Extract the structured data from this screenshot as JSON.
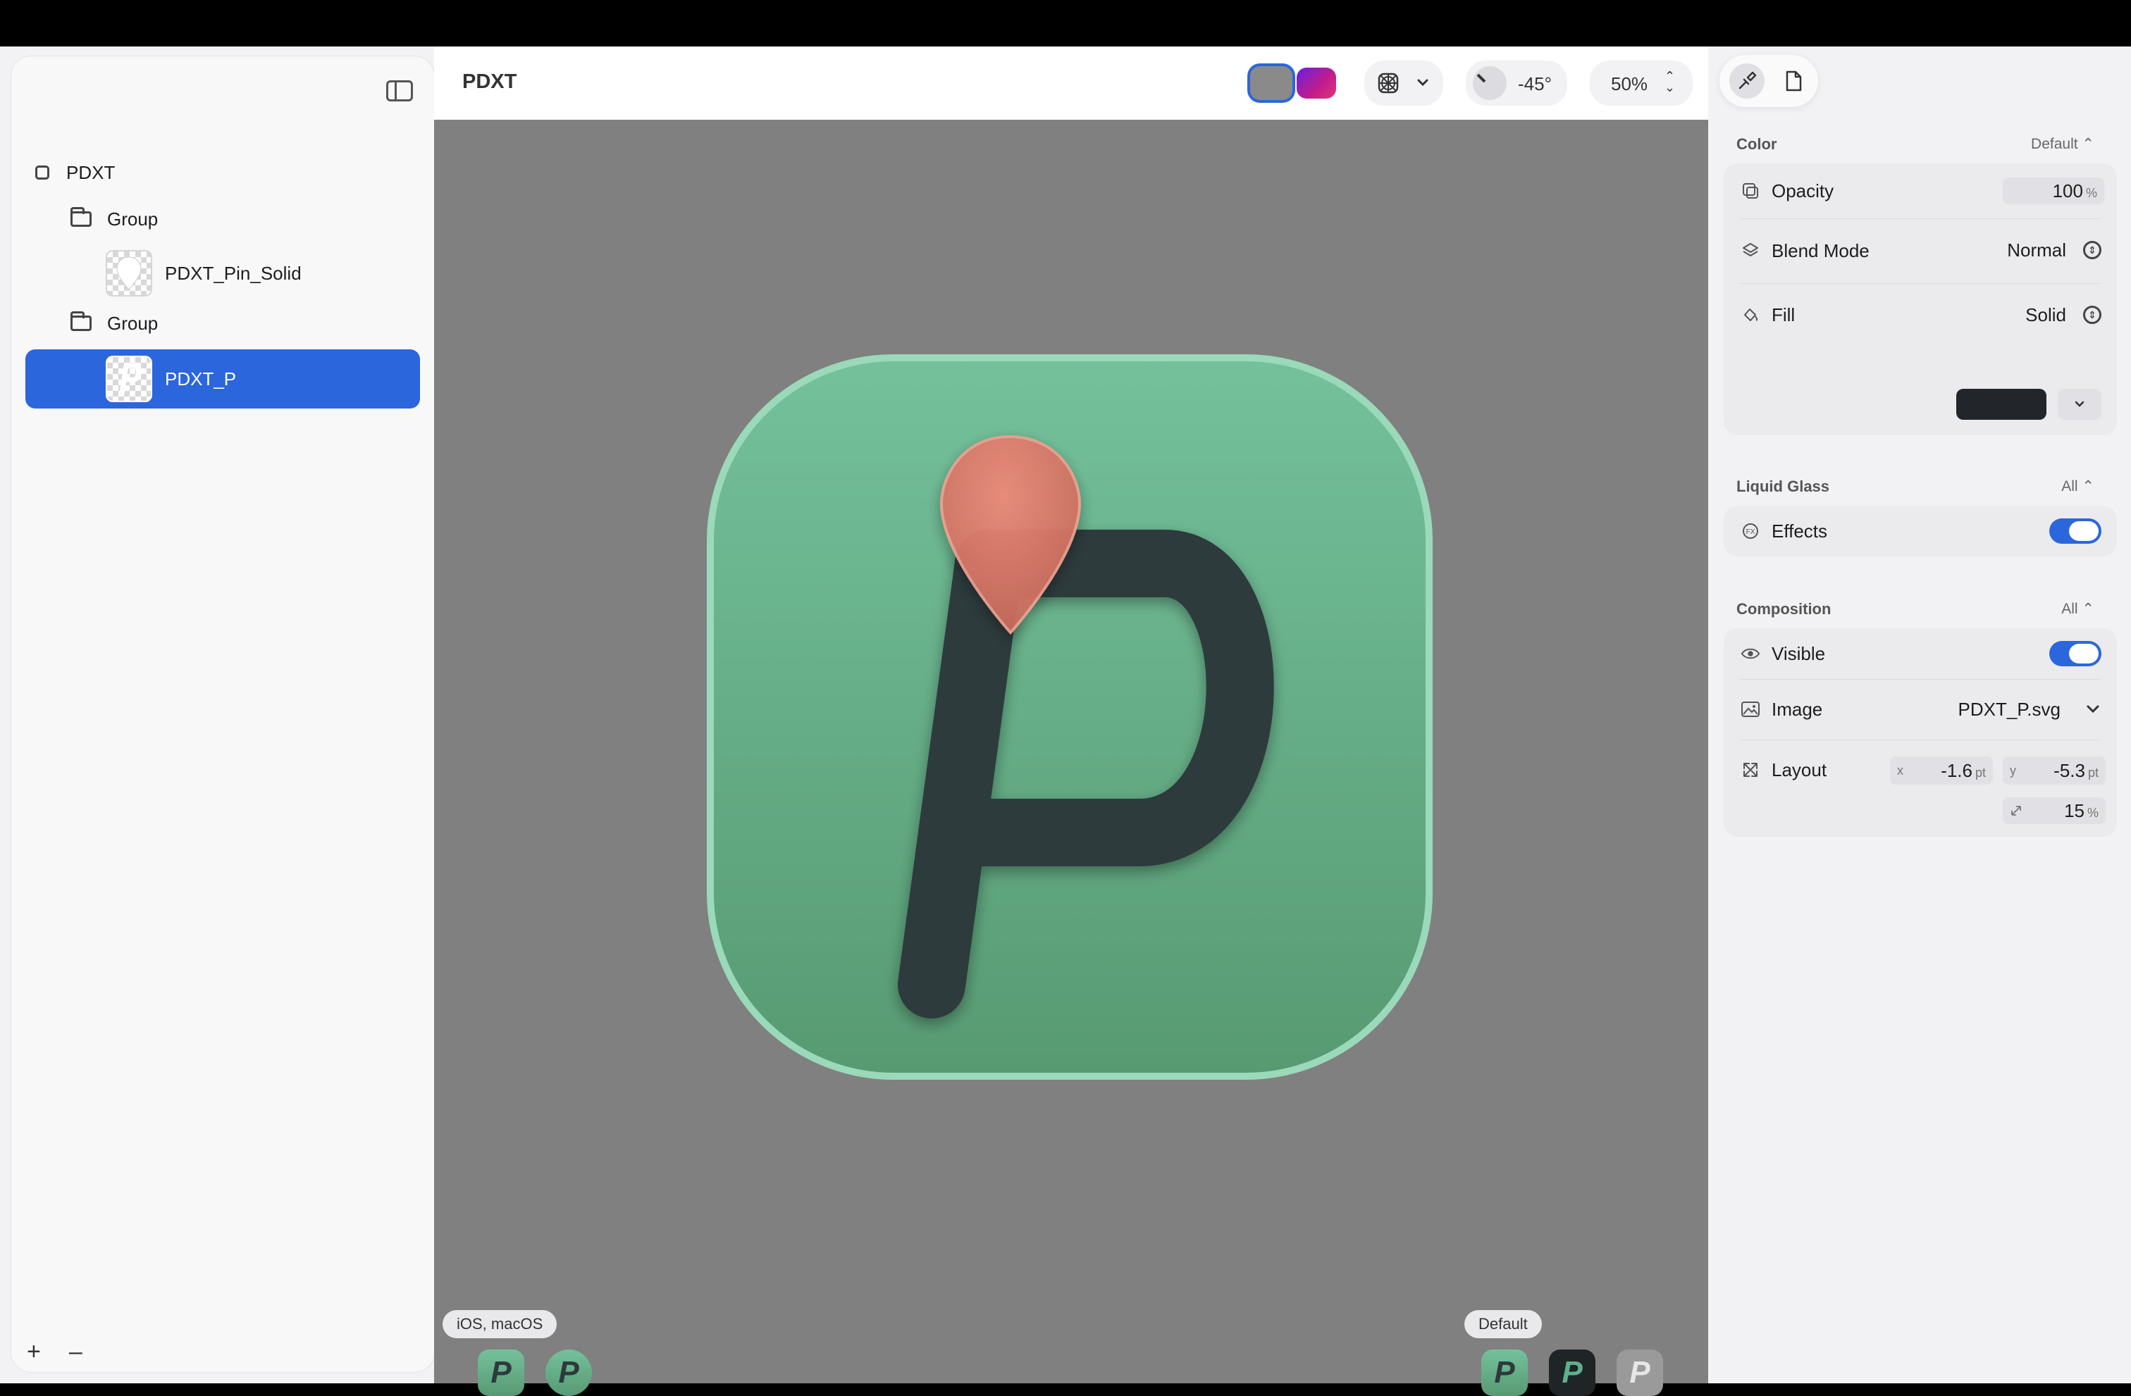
{
  "sidebar": {
    "items": [
      {
        "label": "PDXT",
        "kind": "document"
      },
      {
        "label": "Group",
        "kind": "group"
      },
      {
        "label": "PDXT_Pin_Solid",
        "kind": "layer"
      },
      {
        "label": "Group",
        "kind": "group"
      },
      {
        "label": "PDXT_P",
        "kind": "layer",
        "selected": true
      }
    ],
    "add_label": "+",
    "remove_label": "–"
  },
  "header": {
    "title": "PDXT",
    "angle": "-45°",
    "zoom": "50%"
  },
  "canvas": {
    "platform_badge": "iOS, macOS",
    "appearance_badge": "Default",
    "icon_letter": "P",
    "colors": {
      "background": "#808080",
      "icon_green": "#67b78f",
      "glyph": "#2d3a3c",
      "pin": "#e07565"
    }
  },
  "inspector": {
    "color": {
      "heading": "Color",
      "mode": "Default ⌃",
      "opacity_label": "Opacity",
      "opacity_value": "100",
      "opacity_unit": "%",
      "blend_label": "Blend Mode",
      "blend_value": "Normal",
      "fill_label": "Fill",
      "fill_value": "Solid",
      "swatch": "#22262a"
    },
    "liquid_glass": {
      "heading": "Liquid Glass",
      "mode": "All ⌃",
      "effects_label": "Effects",
      "effects_on": true
    },
    "composition": {
      "heading": "Composition",
      "mode": "All ⌃",
      "visible_label": "Visible",
      "visible_on": true,
      "image_label": "Image",
      "image_value": "PDXT_P.svg",
      "layout_label": "Layout",
      "x_label": "x",
      "x_value": "-1.6",
      "y_label": "y",
      "y_value": "-5.3",
      "unit_pt": "pt",
      "scale_value": "15",
      "scale_unit": "%"
    }
  }
}
